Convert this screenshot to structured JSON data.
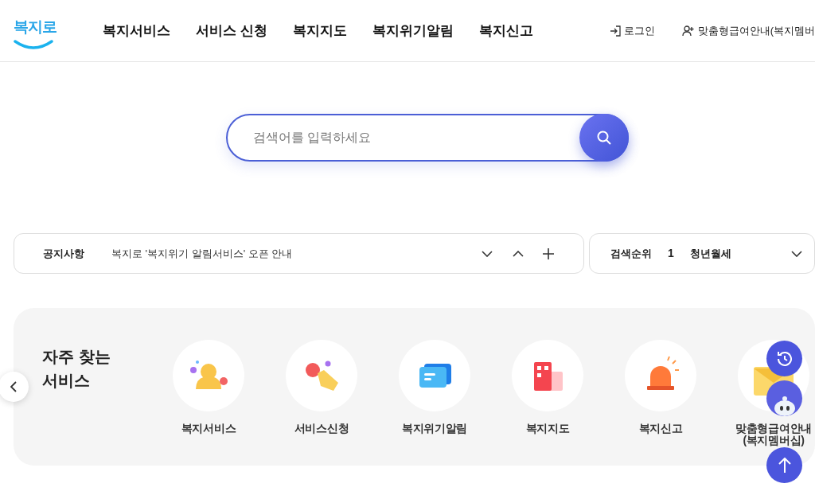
{
  "header": {
    "logo": "복지로",
    "nav": [
      "복지서비스",
      "서비스 신청",
      "복지지도",
      "복지위기알림",
      "복지신고"
    ],
    "utility": [
      {
        "kind": "login",
        "label": "로그인"
      },
      {
        "kind": "member",
        "label": "맞춤형급여안내(복지멤버"
      }
    ]
  },
  "search": {
    "placeholder": "검색어를 입력하세요"
  },
  "notice": {
    "label": "공지사항",
    "text": "복지로 '복지위기 알림서비스' 오픈 안내"
  },
  "ranking": {
    "label": "검색순위",
    "rank": "1",
    "keyword": "청년월세"
  },
  "services": {
    "title": "자주 찾는 서비스",
    "items": [
      {
        "kind": "people",
        "label": "복지서비스"
      },
      {
        "kind": "hand",
        "label": "서비스신청"
      },
      {
        "kind": "message",
        "label": "복지위기알림"
      },
      {
        "kind": "map",
        "label": "복지지도"
      },
      {
        "kind": "siren",
        "label": "복지신고"
      },
      {
        "kind": "mail",
        "label": "맞춤형급여안내\n(복지멤버십)"
      }
    ]
  }
}
